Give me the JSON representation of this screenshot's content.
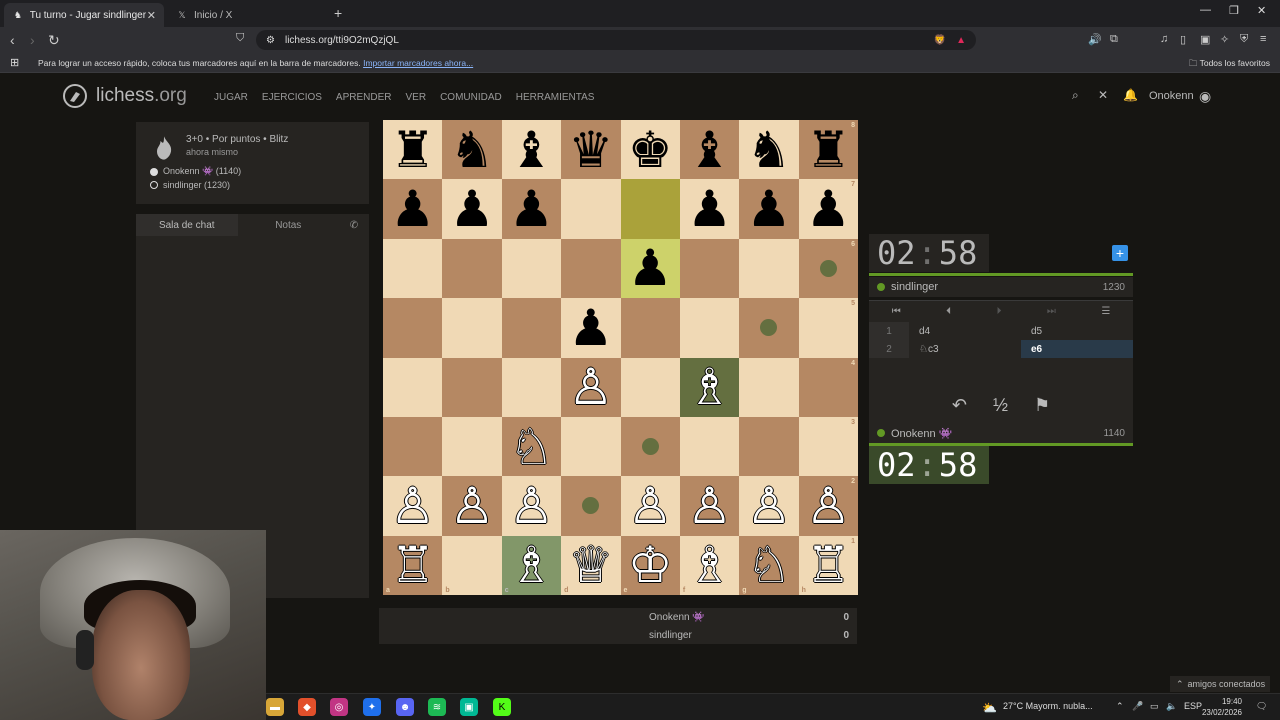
{
  "browser": {
    "tabs": [
      {
        "title": "Tu turno - Jugar sindlinger • l",
        "active": true
      },
      {
        "title": "Inicio / X",
        "active": false
      }
    ],
    "url": "lichess.org/tti9O2mQzjQL",
    "bookmarks_hint": "Para lograr un acceso rápido, coloca tus marcadores aquí en la barra de marcadores.",
    "bookmarks_import": "Importar marcadores ahora...",
    "all_favorites": "Todos los favoritos"
  },
  "site": {
    "logo": "lichess",
    "logo_tld": ".org",
    "nav": [
      "JUGAR",
      "EJERCICIOS",
      "APRENDER",
      "VER",
      "COMUNIDAD",
      "HERRAMIENTAS"
    ],
    "username": "Onokenn"
  },
  "game_info": {
    "setup": "3+0 • Por puntos • Blitz",
    "time_ago": "ahora mismo",
    "white_player": "Onokenn 👾 (1140)",
    "black_player": "sindlinger (1230)"
  },
  "chat": {
    "tab_chat": "Sala de chat",
    "tab_notes": "Notas"
  },
  "board": {
    "ranks": [
      "8",
      "7",
      "6",
      "5",
      "4",
      "3",
      "2",
      "1"
    ],
    "files": [
      "a",
      "b",
      "c",
      "d",
      "e",
      "f",
      "g",
      "h"
    ],
    "position": [
      [
        "♜",
        "♞",
        "♝",
        "♛",
        "♚",
        "♝",
        "♞",
        "♜"
      ],
      [
        "♟",
        "♟",
        "♟",
        "",
        "",
        "♟",
        "♟",
        "♟"
      ],
      [
        "",
        "",
        "",
        "",
        "♟",
        "",
        "",
        ""
      ],
      [
        "",
        "",
        "",
        "♟",
        "",
        "",
        "",
        ""
      ],
      [
        "",
        "",
        "",
        "♙",
        "",
        "♗",
        "",
        ""
      ],
      [
        "",
        "",
        "♘",
        "",
        "",
        "",
        "",
        ""
      ],
      [
        "♙",
        "♙",
        "♙",
        "",
        "♙",
        "♙",
        "♙",
        "♙"
      ],
      [
        "♖",
        "",
        "♗",
        "♕",
        "♔",
        "♗",
        "♘",
        "♖"
      ]
    ]
  },
  "top_player": {
    "name": "sindlinger",
    "rating": "1230",
    "clock_min": "02",
    "clock_sec": "58"
  },
  "bottom_player": {
    "name": "Onokenn 👾",
    "rating": "1140",
    "clock_min": "02",
    "clock_sec": "58"
  },
  "moves": [
    {
      "num": "1",
      "white": "d4",
      "black": "d5"
    },
    {
      "num": "2",
      "white": "♘c3",
      "black": "e6"
    }
  ],
  "actions": {
    "takeback": "↶",
    "draw": "½",
    "resign": "⚑"
  },
  "score": [
    {
      "name": "Onokenn 👾",
      "points": "0"
    },
    {
      "name": "sindlinger",
      "points": "0"
    }
  ],
  "taskbar": {
    "weather": "27°C  Mayorm. nubla...",
    "lang": "ESP",
    "time": "19:40",
    "date": "23/02/2026"
  },
  "friends": "amigos conectados"
}
